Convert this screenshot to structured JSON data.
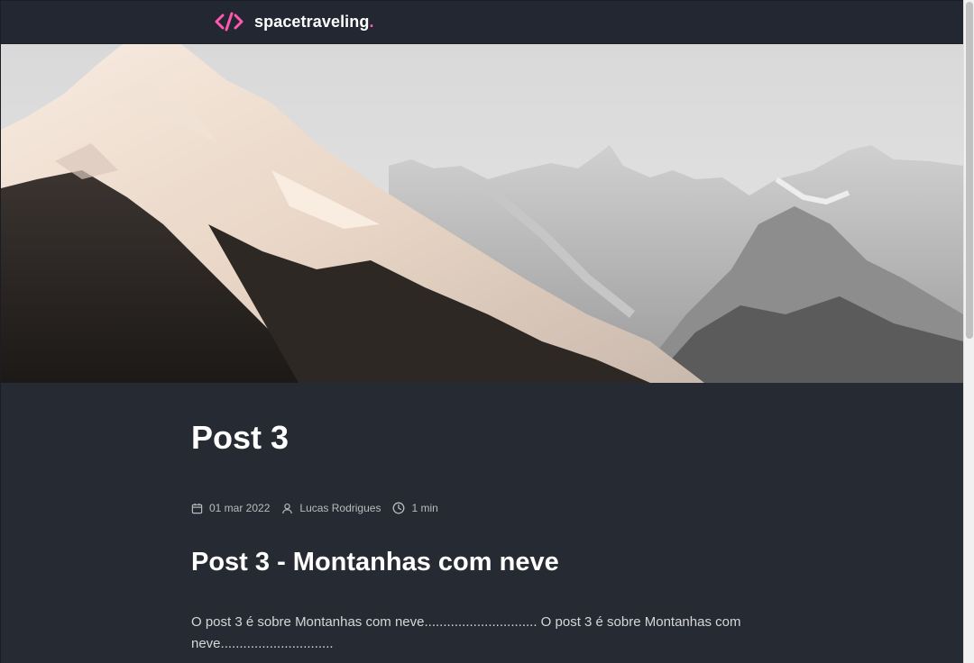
{
  "header": {
    "logo_text": "spacetraveling",
    "logo_dot": ".",
    "accent_color": "#ff57b2",
    "icon": "code-brackets-icon"
  },
  "banner": {
    "description_icon": "snowy-mountains-image"
  },
  "post": {
    "title": "Post 3",
    "meta": {
      "date": "01 mar 2022",
      "author": "Lucas Rodrigues",
      "reading_time": "1 min"
    },
    "sections": [
      {
        "heading": "Post 3 - Montanhas com neve",
        "body": "O post 3 é sobre Montanhas com neve.............................. O post 3 é sobre Montanhas com neve.............................."
      }
    ]
  },
  "colors": {
    "background": "#252a33",
    "header_background": "#222731",
    "text": "#ffffff",
    "meta_text": "#bbbbbb"
  }
}
